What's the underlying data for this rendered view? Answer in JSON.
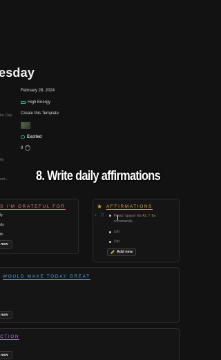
{
  "page": {
    "title": "esday"
  },
  "properties": [
    {
      "label": "",
      "value": "February 28, 2024",
      "icon": ""
    },
    {
      "label": "he Day",
      "value": "High Energy",
      "icon": "battery-icon"
    },
    {
      "label": "",
      "value": "Create this Template",
      "icon": ""
    },
    {
      "label": "",
      "value": "",
      "icon": "image-thumbnail-icon"
    },
    {
      "label": "",
      "value": "Excited",
      "icon": "smile-icon"
    },
    {
      "label": "",
      "value": "9",
      "icon": "progress-ring-icon"
    }
  ],
  "side_labels": {
    "ity": "ity",
    "ent": "ent..."
  },
  "caption": "8. Write daily affirmations",
  "gratitude": {
    "title": "S I'M GRATEFUL FOR",
    "items": [
      "ly",
      "ds",
      "th"
    ],
    "new_label": "new"
  },
  "affirmations": {
    "title": "AFFIRMATIONS",
    "placeholder": "Press 'space' for AI, '/' for commands...",
    "items": [
      "List",
      "List"
    ],
    "new_label": "Add new",
    "handle": "+ ⠿"
  },
  "great": {
    "title": "WOULD MAKE TODAY GREAT",
    "new_label": "new"
  },
  "action": {
    "title": "CTION",
    "new_label": "new"
  },
  "colors": {
    "background": "#121212",
    "gratitude": "#e07a7a",
    "affirmations": "#d9a441",
    "great": "#5b9bd5",
    "action": "#b46cd8"
  }
}
